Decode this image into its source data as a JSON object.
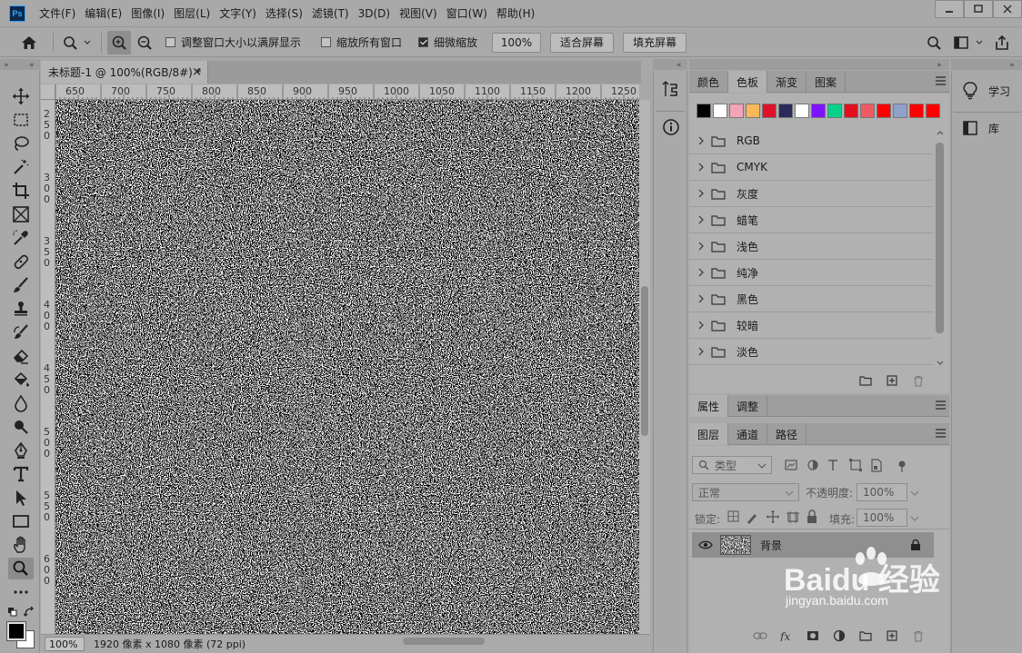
{
  "app": {
    "logo": "Ps",
    "menu": [
      "文件(F)",
      "编辑(E)",
      "图像(I)",
      "图层(L)",
      "文字(Y)",
      "选择(S)",
      "滤镜(T)",
      "3D(D)",
      "视图(V)",
      "窗口(W)",
      "帮助(H)"
    ]
  },
  "options_bar": {
    "resize_windows_label": "调整窗口大小以满屏显示",
    "resize_windows_checked": false,
    "zoom_all_label": "缩放所有窗口",
    "zoom_all_checked": false,
    "scrubby_label": "细微缩放",
    "scrubby_checked": true,
    "zoom_value": "100%",
    "fit_screen": "适合屏幕",
    "fill_screen": "填充屏幕"
  },
  "document": {
    "tab_title": "未标题-1 @ 100%(RGB/8#) *",
    "close_glyph": "×",
    "ruler_h": [
      "650",
      "700",
      "750",
      "800",
      "850",
      "900",
      "950",
      "1000",
      "1050",
      "1100",
      "1150",
      "1200",
      "1250"
    ],
    "ruler_v": [
      [
        "2",
        "5",
        "0"
      ],
      [
        "3",
        "0",
        "0"
      ],
      [
        "3",
        "5",
        "0"
      ],
      [
        "4",
        "0",
        "0"
      ],
      [
        "4",
        "5",
        "0"
      ],
      [
        "5",
        "0",
        "0"
      ],
      [
        "5",
        "5",
        "0"
      ],
      [
        "6",
        "0",
        "0"
      ]
    ],
    "status_zoom": "100%",
    "status_info": "1920 像素 x 1080 像素 (72 ppi)"
  },
  "swatches_panel": {
    "tabs": [
      "颜色",
      "色板",
      "渐变",
      "图案"
    ],
    "active_tab": "色板",
    "colors": [
      "#000000",
      "#ffffff",
      "#f4a4b4",
      "#f9b95a",
      "#e1102a",
      "#2b2a5a",
      "#ffffff",
      "#7f12ff",
      "#05d18a",
      "#e30f1d",
      "#ee5a64",
      "#ff0000",
      "#8fa1c8",
      "#ff0000",
      "#ff0000"
    ],
    "groups": [
      "RGB",
      "CMYK",
      "灰度",
      "蜡笔",
      "浅色",
      "纯净",
      "黑色",
      "较暗",
      "淡色"
    ]
  },
  "properties_panel": {
    "tabs": [
      "属性",
      "调整"
    ]
  },
  "layers_panel": {
    "tabs": [
      "图层",
      "通道",
      "路径"
    ],
    "filter_kind": "类型",
    "blend_mode": "正常",
    "opacity_label": "不透明度:",
    "opacity_value": "100%",
    "lock_label": "锁定:",
    "fill_label": "填充:",
    "fill_value": "100%",
    "layers": [
      {
        "name": "背景",
        "locked": true,
        "visible": true
      }
    ]
  },
  "right_column": {
    "learn": "学习",
    "libraries": "库"
  },
  "watermark": {
    "title": "Baidu 经验",
    "url": "jingyan.baidu.com"
  }
}
